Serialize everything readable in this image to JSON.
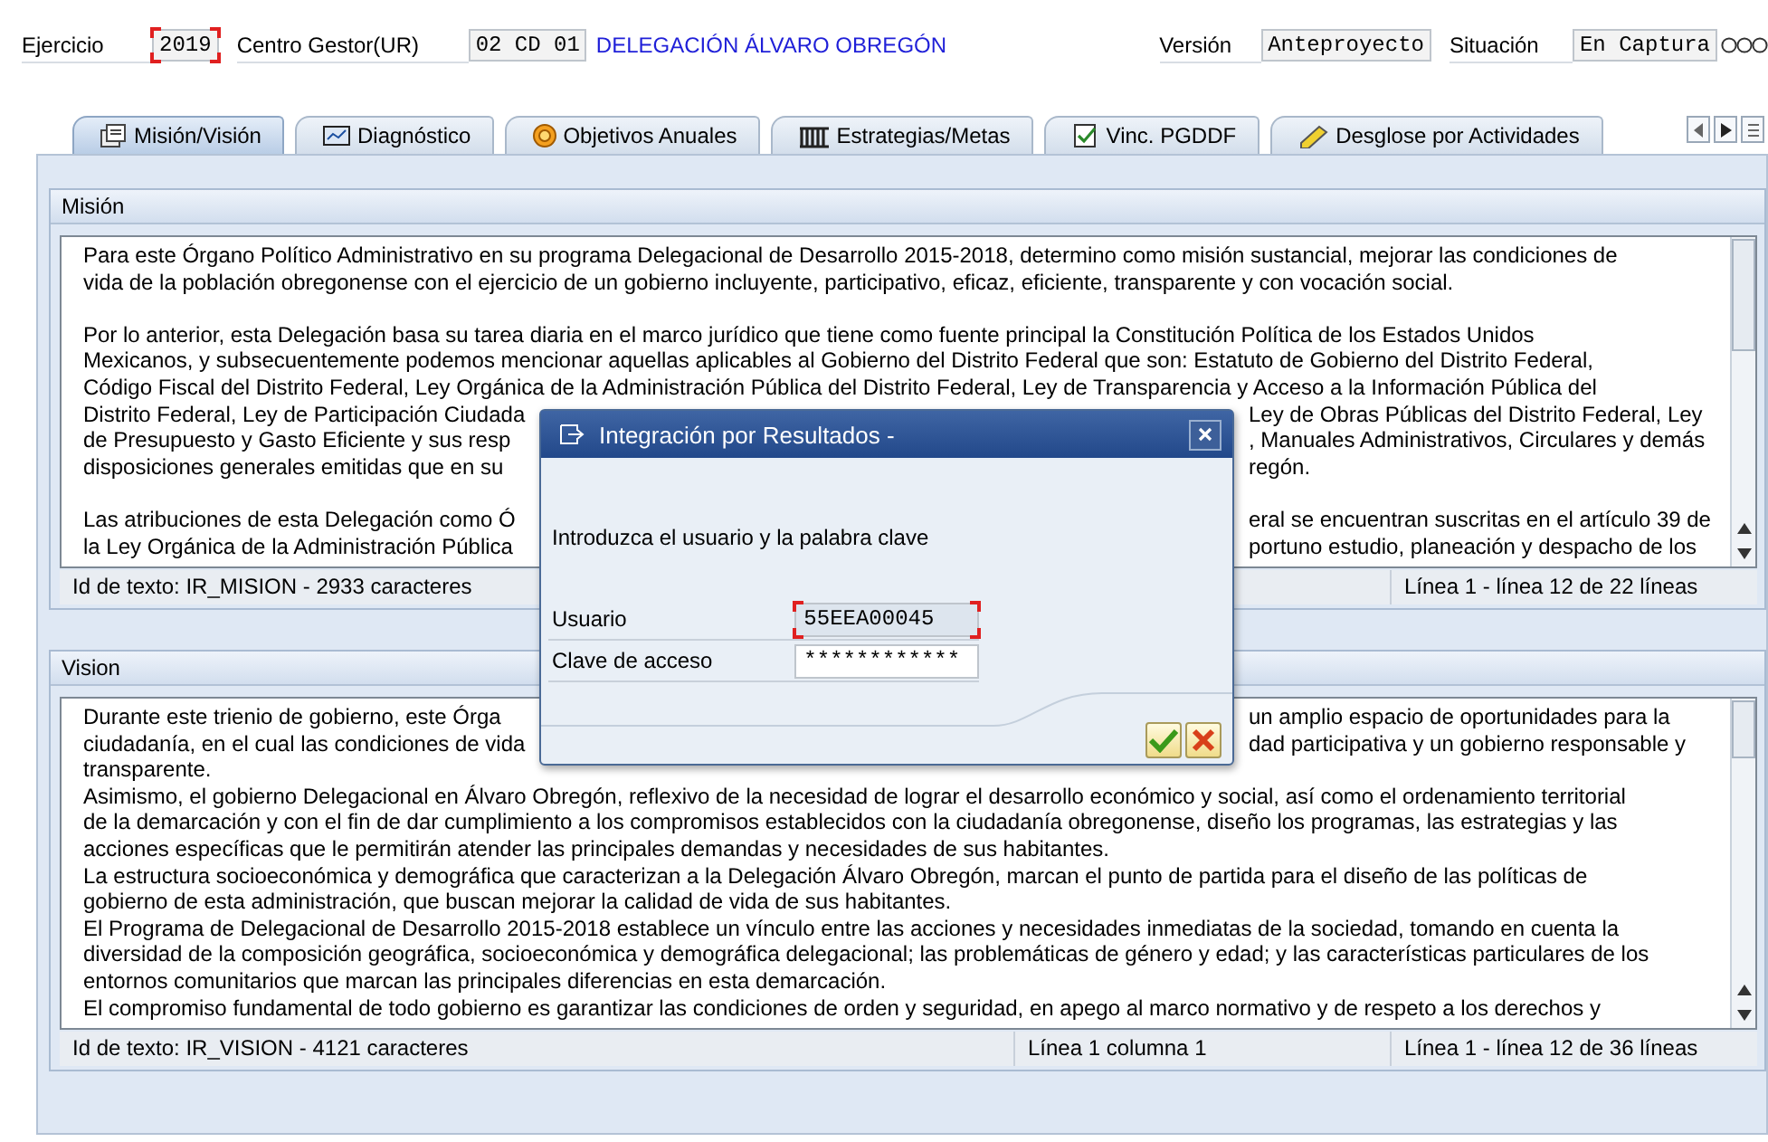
{
  "header": {
    "ejercicio": {
      "label": "Ejercicio",
      "value": "2019",
      "focused": true
    },
    "centro_gestor": {
      "label": "Centro Gestor(UR)",
      "value": "02 CD 01",
      "description": "DELEGACIÓN ÁLVARO OBREGÓN"
    },
    "version": {
      "label": "Versión",
      "value": "Anteproyecto"
    },
    "situacion": {
      "label": "Situación",
      "value": "En Captura"
    }
  },
  "tabs": [
    {
      "label": "Misión/Visión",
      "selected": true
    },
    {
      "label": "Diagnóstico",
      "selected": false
    },
    {
      "label": "Objetivos Anuales",
      "selected": false
    },
    {
      "label": "Estrategias/Metas",
      "selected": false
    },
    {
      "label": "Vinc. PGDDF",
      "selected": false
    },
    {
      "label": "Desglose por Actividades",
      "selected": false
    }
  ],
  "sections": [
    {
      "title": "Misión",
      "lines": [
        {
          "kind": "text",
          "text": "Para este Órgano Político Administrativo en su programa Delegacional de Desarrollo 2015-2018, determino como misión sustancial, mejorar las condiciones de"
        },
        {
          "kind": "text",
          "text": "vida de la población obregonense con el ejercicio de un gobierno incluyente, participativo, eficaz, eficiente, transparente y con vocación social."
        },
        {
          "kind": "blank"
        },
        {
          "kind": "text",
          "text": "Por lo anterior, esta Delegación basa su tarea diaria en el marco jurídico que tiene como fuente principal la Constitución Política de los Estados Unidos"
        },
        {
          "kind": "text",
          "text": "Mexicanos, y subsecuentemente podemos mencionar aquellas aplicables al Gobierno del Distrito Federal que son: Estatuto de Gobierno del Distrito Federal,"
        },
        {
          "kind": "text",
          "text": "Código Fiscal del Distrito Federal,  Ley Orgánica de la Administración Pública del Distrito Federal, Ley de Transparencia y Acceso a la Información Pública del"
        },
        {
          "kind": "split",
          "left": "Distrito Federal, Ley de Participación Ciudada",
          "right": "Ley de Obras Públicas del Distrito Federal, Ley"
        },
        {
          "kind": "split",
          "left": "de Presupuesto y Gasto Eficiente y sus resp",
          "right": ", Manuales Administrativos, Circulares y demás"
        },
        {
          "kind": "split",
          "left": "disposiciones generales emitidas     que en su",
          "right": "regón."
        },
        {
          "kind": "blank"
        },
        {
          "kind": "split",
          "left": "Las atribuciones de esta Delegación como Ó",
          "right": "eral se encuentran suscritas en el artículo 39 de"
        },
        {
          "kind": "split",
          "left": "la Ley Orgánica de la Administración Pública",
          "right": "portuno estudio, planeación y despacho de los"
        }
      ],
      "status": {
        "text_id": "Id de texto: IR_MISION - 2933 caracteres",
        "lines": "Línea 1 - línea 12 de 22 líneas"
      }
    },
    {
      "title": "Vision",
      "lines": [
        {
          "kind": "split",
          "left": "Durante este trienio de gobierno, este Órga",
          "right": "un amplio espacio de oportunidades para la"
        },
        {
          "kind": "split",
          "left": "ciudadanía, en el cual las condiciones de vida",
          "right": "dad participativa y un gobierno responsable y"
        },
        {
          "kind": "text",
          "text": "transparente."
        },
        {
          "kind": "text",
          "text": "Asimismo, el gobierno Delegacional en Álvaro Obregón, reflexivo de la necesidad de lograr el desarrollo económico y social, así como el ordenamiento territorial"
        },
        {
          "kind": "text",
          "text": "de la demarcación y con el fin de dar cumplimiento a los compromisos establecidos con la ciudadanía obregonense, diseño los programas, las estrategias y las"
        },
        {
          "kind": "text",
          "text": "acciones específicas que le permitirán atender las principales demandas y necesidades de sus habitantes."
        },
        {
          "kind": "text",
          "text": "La estructura socioeconómica y demográfica que caracterizan a la Delegación Álvaro Obregón, marcan el punto de partida para el diseño de las políticas de"
        },
        {
          "kind": "text",
          "text": "gobierno de esta administración, que buscan mejorar la calidad de vida de sus habitantes."
        },
        {
          "kind": "text",
          "text": "El Programa de Delegacional de Desarrollo 2015-2018 establece un vínculo entre las acciones y necesidades inmediatas de la sociedad, tomando en cuenta la"
        },
        {
          "kind": "text",
          "text": "diversidad de la composición geográfica, socioeconómica y demográfica delegacional; las problemáticas de género y edad; y las características particulares de los"
        },
        {
          "kind": "text",
          "text": "entornos comunitarios que marcan las principales diferencias en esta demarcación."
        },
        {
          "kind": "text",
          "text": "El compromiso fundamental de todo gobierno es garantizar las condiciones de orden y seguridad, en apego al marco normativo y de respeto a los derechos y"
        }
      ],
      "status": {
        "text_id": "Id de texto: IR_VISION - 4121 caracteres",
        "position": "Línea 1 columna 1",
        "lines": "Línea 1 - línea 12 de 36 líneas"
      }
    }
  ],
  "dialog": {
    "title": "Integración por Resultados -",
    "message": "Introduzca el usuario y la palabra clave",
    "fields": [
      {
        "label": "Usuario",
        "value": "55EEA00045",
        "focused": true,
        "kind": "text"
      },
      {
        "label": "Clave de acceso",
        "value": "************",
        "focused": false,
        "kind": "password"
      }
    ]
  }
}
